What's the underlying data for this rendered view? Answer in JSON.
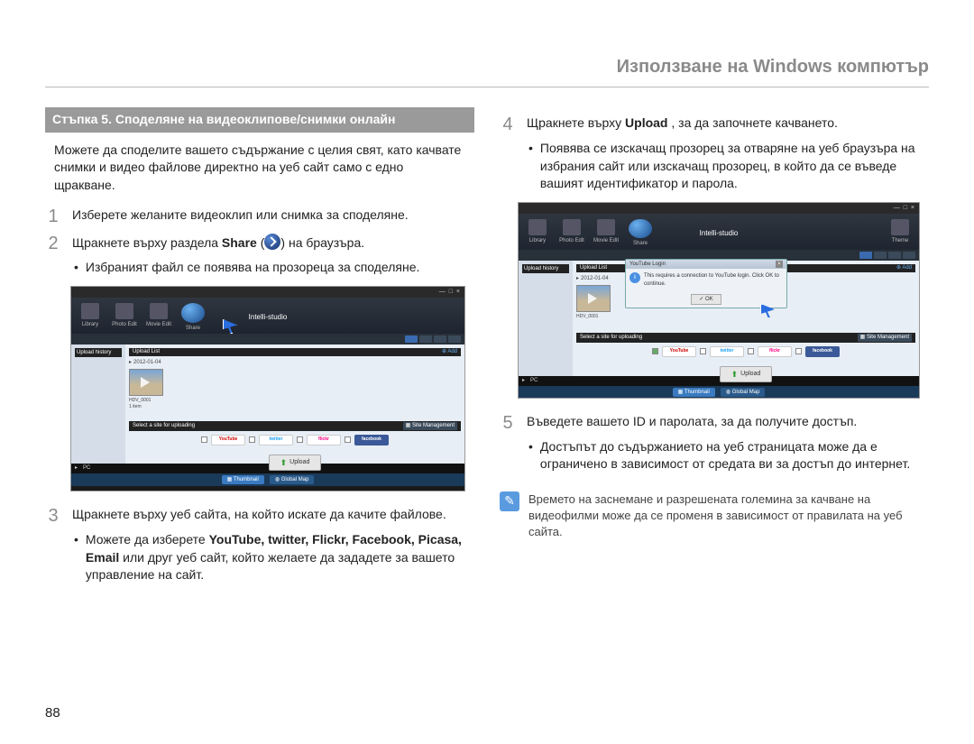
{
  "header": "Използване на Windows компютър",
  "page_number": "88",
  "left": {
    "step_title": "Стъпка 5. Споделяне на видеоклипове/снимки онлайн",
    "intro": "Можете да споделите вашето съдържание с целия свят, като качвате снимки и видео файлове директно на уеб сайт само с едно щракване.",
    "item1": "Изберете желаните видеоклип или снимка за споделяне.",
    "item2_pre": "Щракнете върху раздела ",
    "item2_bold": "Share",
    "item2_post": " на браузъра.",
    "item2_sub": "Избраният файл се появява на прозореца за споделяне.",
    "item3": "Щракнете върху уеб сайта, на който искате да качите файлове.",
    "item3_sub_pre": "Можете да изберете ",
    "item3_sub_bold": "YouTube, twitter, Flickr, Facebook, Picasa, Email",
    "item3_sub_post": " или друг уеб сайт, който желаете да зададете за вашето управление на сайт."
  },
  "right": {
    "item4_pre": "Щракнете върху ",
    "item4_bold": "Upload",
    "item4_post": ", за да започнете качването.",
    "item4_sub": "Появява се изскачащ прозорец за отваряне на уеб браузъра на избрания сайт или изскачащ прозорец, в който да се въведе вашият идентификатор и парола.",
    "item5": "Въведете вашето ID и паролата, за да получите достъп.",
    "item5_sub": "Достъпът до съдържанието на уеб страницата може да е ограничено в зависимост от средата ви за достъп до интернет.",
    "note": "Времето на заснемане и разрешената големина за качване на видеофилми може да се променя в зависимост от правилата на уеб сайта."
  },
  "ss": {
    "app_title": "Intelli-studio",
    "tb": {
      "library": "Library",
      "photo_edit": "Photo Edit",
      "movie_edit": "Movie Edit",
      "share": "Share",
      "theme": "Theme"
    },
    "left_header": "Upload history",
    "main_header": "Upload List",
    "add": "Add",
    "date": "2012-01-04",
    "thumb_label": "HDV_0001",
    "item_count": "1 item",
    "select_text": "Select a site for uploading",
    "site_mgmt": "Site Management",
    "sites": {
      "youtube": "YouTube",
      "twitter": "twitter",
      "flickr": "flickr",
      "facebook": "facebook"
    },
    "upload": "Upload",
    "footer_thumb": "Thumbnail",
    "footer_global": "Global Map",
    "pc": "PC",
    "dialog_title": "YouTube Login",
    "dialog_msg": "This requires a connection to YouTube login. Click OK to continue.",
    "ok": "OK"
  }
}
